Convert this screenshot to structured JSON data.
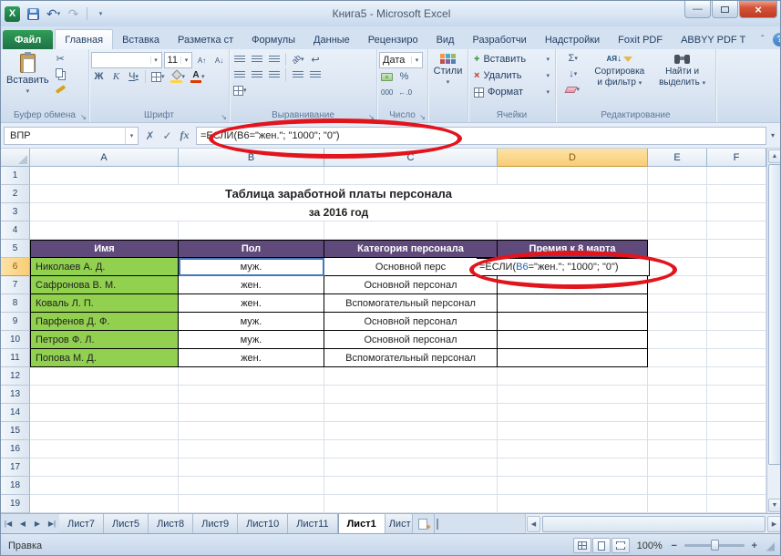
{
  "titlebar": {
    "title": "Книга5 - Microsoft Excel"
  },
  "icons": {
    "dropdown": "▾",
    "check": "✓",
    "cancel": "✗",
    "fx": "fx",
    "collapse": "ˆ",
    "help": "?",
    "minimize": "—",
    "close": "×",
    "scissors": "✂",
    "undo": "↶",
    "redo": "↷",
    "sigma": "Σ",
    "fill_down": "↓",
    "sort_letters": "АЯ",
    "sort_arrow": "↓",
    "percent": "%",
    "thousands": "000",
    "dec_inc": "←.0",
    "dec_dec": ".00→",
    "orientation": "ab",
    "wrap": "↩",
    "plus": "+",
    "cross": "×",
    "nav_first": "|◀",
    "nav_prev": "◀",
    "nav_next": "▶",
    "nav_last": "▶|",
    "up": "▲",
    "down": "▼",
    "left": "◀",
    "right": "▶",
    "grow_font": "А↑",
    "shrink_font": "А↓",
    "minus": "−",
    "launcher": "↘",
    "grip": "◢",
    "logo": "X"
  },
  "ribbon_tabs": {
    "file": "Файл",
    "items": [
      "Главная",
      "Вставка",
      "Разметка ст",
      "Формулы",
      "Данные",
      "Рецензиро",
      "Вид",
      "Разработчи",
      "Надстройки",
      "Foxit PDF",
      "ABBYY PDF T"
    ]
  },
  "clipboard": {
    "group": "Буфер обмена",
    "paste": "Вставить"
  },
  "font": {
    "group": "Шрифт",
    "name": "",
    "size": "11",
    "bold": "Ж",
    "italic": "К",
    "underline": "Ч"
  },
  "alignment": {
    "group": "Выравнивание"
  },
  "number": {
    "group": "Число",
    "format": "Дата"
  },
  "styles": {
    "button": "Стили"
  },
  "cells": {
    "group": "Ячейки",
    "insert": "Вставить",
    "del": "Удалить",
    "format": "Формат"
  },
  "editing": {
    "group": "Редактирование",
    "sort1": "Сортировка",
    "sort2": "и фильтр",
    "find1": "Найти и",
    "find2": "выделить"
  },
  "formula_bar": {
    "name_box": "ВПР",
    "formula": "=ЕСЛИ(B6=\"жен.\"; \"1000\"; \"0\")"
  },
  "columns": [
    "A",
    "B",
    "C",
    "D",
    "E",
    "F"
  ],
  "row_numbers": [
    "1",
    "2",
    "3",
    "4",
    "5",
    "6",
    "7",
    "8",
    "9",
    "10",
    "11",
    "12",
    "13",
    "14",
    "15",
    "16",
    "17",
    "18",
    "19"
  ],
  "sheet": {
    "title1": "Таблица заработной платы персонала",
    "title2": "за 2016 год",
    "headers": [
      "Имя",
      "Пол",
      "Категория персонала",
      "Премия к 8 марта"
    ],
    "names": [
      "Николаев А. Д.",
      "Сафронова В. М.",
      "Коваль Л. П.",
      "Парфенов Д. Ф.",
      "Петров Ф. Л.",
      "Попова М. Д."
    ],
    "genders": [
      "муж.",
      "жен.",
      "жен.",
      "муж.",
      "муж.",
      "жен."
    ],
    "categories": [
      "Основной перс",
      "Основной персонал",
      "Вспомогательный персонал",
      "Основной персонал",
      "Основной персонал",
      "Вспомогательный персонал"
    ]
  },
  "cell_edit": {
    "p1": "=ЕСЛИ(",
    "ref": "B6",
    "p2": "=\"жен.\"; \"1000\"; \"0\")"
  },
  "sheet_tabs": [
    "Лист7",
    "Лист5",
    "Лист8",
    "Лист9",
    "Лист10",
    "Лист11",
    "Лист1",
    "Лист"
  ],
  "status": {
    "mode": "Правка",
    "zoom": "100%"
  },
  "colors": {
    "annotation": "#e2141c",
    "table_header": "#604a7b",
    "name_fill": "#92d050",
    "file_tab": "#1f7246",
    "selected_header": "#f8cd74"
  }
}
